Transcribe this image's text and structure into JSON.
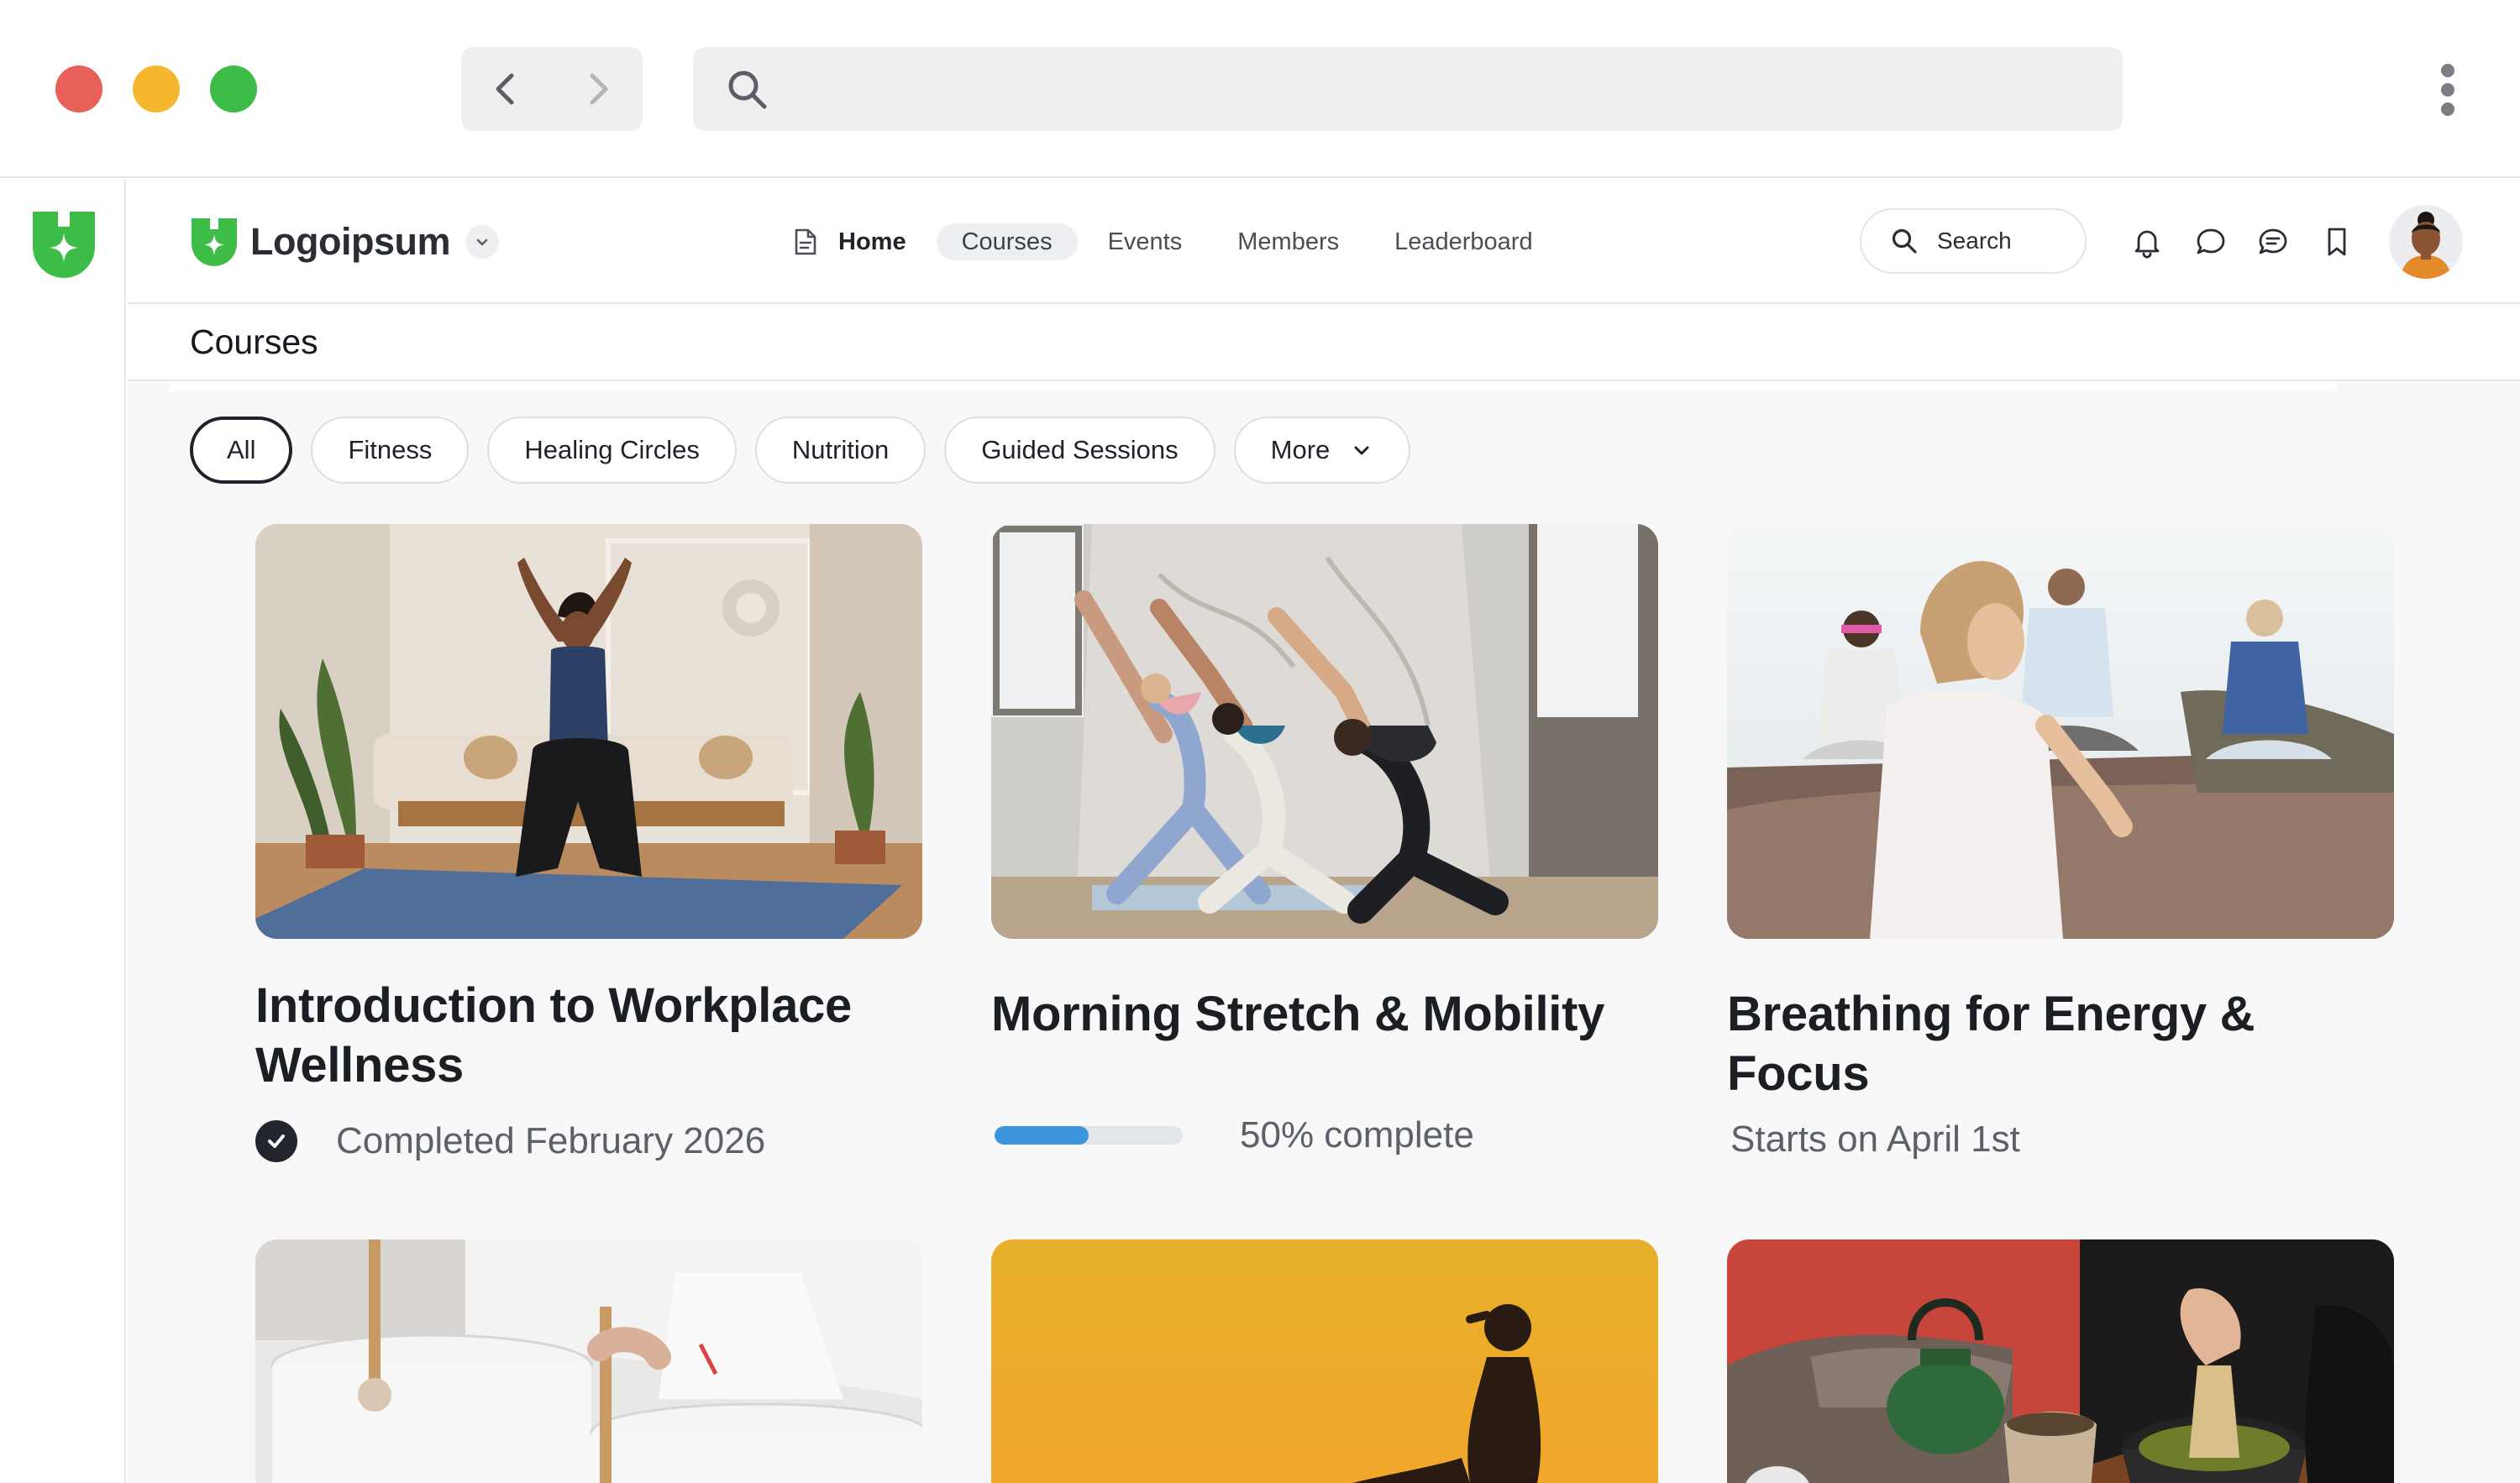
{
  "app": {
    "brand_name": "Logoipsum",
    "brand_color": "#3dbc47"
  },
  "nav": {
    "items": [
      {
        "label": "Home"
      },
      {
        "label": "Courses"
      },
      {
        "label": "Events"
      },
      {
        "label": "Members"
      },
      {
        "label": "Leaderboard"
      }
    ],
    "active": "Courses",
    "search_label": "Search"
  },
  "header_icons": [
    "bell-icon",
    "chat-bubble-icon",
    "messages-icon",
    "bookmark-icon"
  ],
  "page": {
    "title": "Courses"
  },
  "filters": {
    "chips": [
      "All",
      "Fitness",
      "Healing Circles",
      "Nutrition",
      "Guided Sessions"
    ],
    "selected": "All",
    "more_label": "More"
  },
  "courses": [
    {
      "title": "Introduction to Workplace Wellness",
      "status": "Completed February 2026",
      "status_icon": "check-circle-icon"
    },
    {
      "title": "Morning Stretch & Mobility",
      "progress": 0.5,
      "status": "50% complete"
    },
    {
      "title": "Breathing for Energy & Focus",
      "status": "Starts on April 1st"
    }
  ],
  "colors": {
    "accent": "#3dbc47",
    "progress": "#3d95db",
    "traffic_red": "#e8605a",
    "traffic_yellow": "#f5b72e",
    "traffic_green": "#3dbc47"
  }
}
